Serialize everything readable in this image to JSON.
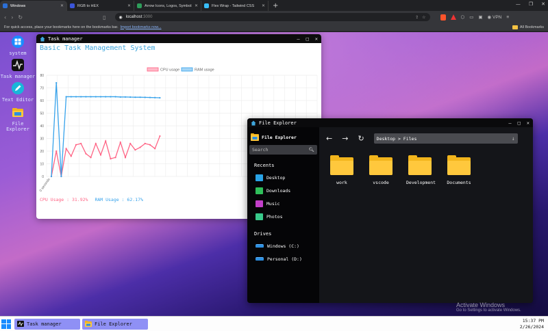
{
  "browser": {
    "tabs": [
      {
        "title": "Windows",
        "active": true,
        "color": "#2b6fd6"
      },
      {
        "title": "RGB to HEX",
        "active": false,
        "color": "#3b55d9"
      },
      {
        "title": "Arrow Icons, Logos, Symbols – Free",
        "active": false,
        "color": "#2e9d5a"
      },
      {
        "title": "Flex Wrap - Tailwind CSS",
        "active": false,
        "color": "#38bdf8"
      }
    ],
    "url_host": "localhost",
    "url_port": ":3000",
    "vpn_label": "VPN",
    "bookmarks_message": "For quick access, place your bookmarks here on the bookmarks bar.",
    "import_link": "Import bookmarks now...",
    "all_bookmarks": "All Bookmarks"
  },
  "desktop": {
    "icons": [
      {
        "label": "system",
        "icon": "windows-logo-icon"
      },
      {
        "label": "Task manager",
        "icon": "activity-pulse-icon"
      },
      {
        "label": "Text Editor",
        "icon": "pencil-icon"
      },
      {
        "label": "File Explorer",
        "icon": "folder-icon"
      }
    ],
    "watermark": {
      "title": "Activate Windows",
      "subtitle": "Go to Settings to activate Windows."
    }
  },
  "task_manager": {
    "window_title": "Task manager",
    "heading": "Basic Task Management System",
    "cpu_text": "CPU Usage : 31.92%",
    "ram_text": "RAM Usage : 62.17%"
  },
  "chart_data": {
    "type": "line",
    "x_tick_label": "0 seconds",
    "ylim": [
      0,
      80
    ],
    "yticks": [
      "0",
      "10",
      "20",
      "30",
      "40",
      "50",
      "60",
      "70",
      "80"
    ],
    "grid": true,
    "legend_position": "top-center",
    "series": [
      {
        "name": "CPU usage",
        "color": "#ff6384",
        "values": [
          0,
          20,
          0,
          22,
          16,
          25,
          26,
          18,
          15,
          26,
          17,
          28,
          14,
          15,
          27,
          15,
          26,
          21,
          23,
          26,
          25,
          22,
          31.92
        ]
      },
      {
        "name": "RAM usage",
        "color": "#36a2eb",
        "values": [
          0,
          74,
          0,
          63,
          63,
          63,
          63,
          63,
          63,
          63,
          63,
          63,
          63,
          63,
          62.8,
          62.8,
          62.7,
          62.6,
          62.6,
          62.5,
          62.4,
          62.3,
          62.17
        ]
      }
    ]
  },
  "file_explorer": {
    "window_title": "File Explorer",
    "brand": "File Explorer",
    "search_placeholder": "Search",
    "recents_label": "Recents",
    "recents": [
      {
        "label": "Desktop",
        "color": "#29a3e6"
      },
      {
        "label": "Downloads",
        "color": "#2fbf5a"
      },
      {
        "label": "Music",
        "color": "#c23fc9"
      },
      {
        "label": "Photos",
        "color": "#38c98a"
      }
    ],
    "drives_label": "Drives",
    "drives": [
      {
        "label": "Windows (C:)"
      },
      {
        "label": "Personal (D:)"
      }
    ],
    "path": "Desktop > Files",
    "folders": [
      {
        "label": "work"
      },
      {
        "label": "vscode"
      },
      {
        "label": "Development"
      },
      {
        "label": "Documents"
      }
    ]
  },
  "taskbar": {
    "items": [
      {
        "label": "Task manager"
      },
      {
        "label": "File Explorer"
      }
    ],
    "time": "15:37 PM",
    "date": "2/26/2024"
  }
}
